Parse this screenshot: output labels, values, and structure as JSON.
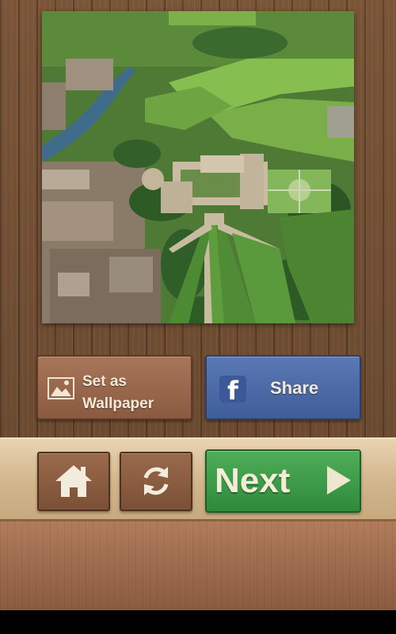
{
  "photo": {
    "subject": "aerial-castle-landscape"
  },
  "buttons": {
    "wallpaper": {
      "icon": "image-icon",
      "line1": "Set as",
      "line2": "Wallpaper"
    },
    "share": {
      "icon": "facebook-icon",
      "fb_letter": "f",
      "label": "Share"
    },
    "home": {
      "icon": "home-icon"
    },
    "refresh": {
      "icon": "refresh-icon"
    },
    "next": {
      "label": "Next",
      "icon": "play-arrow-icon"
    }
  },
  "colors": {
    "wood": "#6f4d33",
    "share_blue": "#4a68a6",
    "next_green": "#3d9a47",
    "bar_tan": "#d8bd94"
  }
}
